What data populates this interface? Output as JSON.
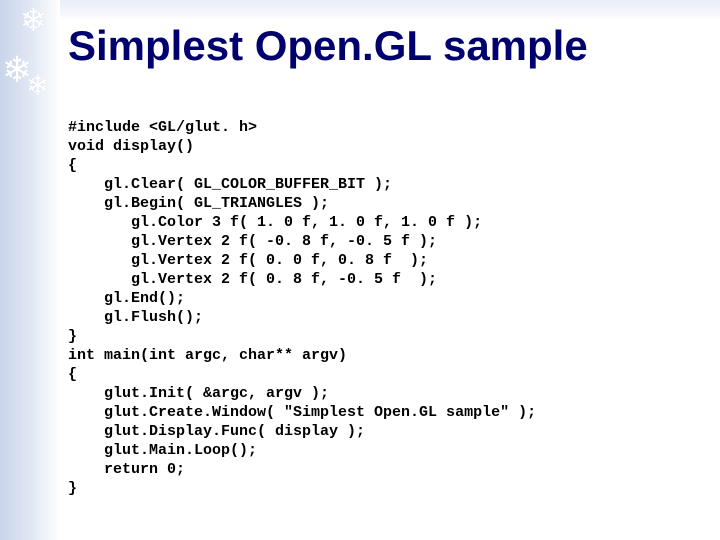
{
  "slide": {
    "title": "Simplest Open.GL sample",
    "code": "#include <GL/glut. h>\nvoid display()\n{\n    gl.Clear( GL_COLOR_BUFFER_BIT );\n    gl.Begin( GL_TRIANGLES );\n       gl.Color 3 f( 1. 0 f, 1. 0 f, 1. 0 f );\n       gl.Vertex 2 f( -0. 8 f, -0. 5 f );\n       gl.Vertex 2 f( 0. 0 f, 0. 8 f  );\n       gl.Vertex 2 f( 0. 8 f, -0. 5 f  );\n    gl.End();\n    gl.Flush();\n}\nint main(int argc, char** argv)\n{\n    glut.Init( &argc, argv );\n    glut.Create.Window( \"Simplest Open.GL sample\" );\n    glut.Display.Func( display );\n    glut.Main.Loop();\n    return 0;\n}"
  },
  "decor": {
    "snowflake_glyph": "❄"
  }
}
